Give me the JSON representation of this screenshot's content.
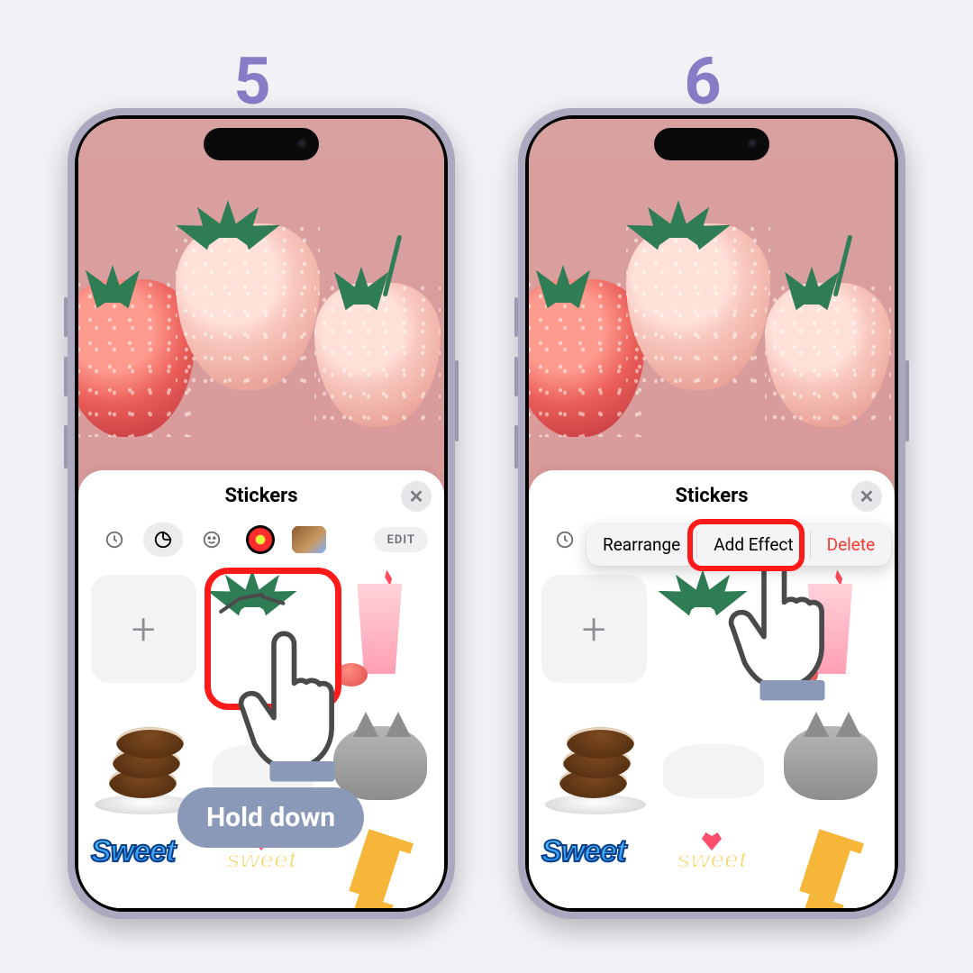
{
  "steps": [
    "5",
    "6"
  ],
  "panel": {
    "title": "Stickers",
    "edit_label": "EDIT"
  },
  "hint": {
    "hold_label": "Hold down"
  },
  "context_menu": {
    "rearrange": "Rearrange",
    "add_effect": "Add Effect",
    "delete": "Delete"
  },
  "icons": {
    "close": "✕",
    "plus": "+"
  },
  "stickers_row3": {
    "sweet": "Sweet",
    "sweet2": "sweet"
  }
}
